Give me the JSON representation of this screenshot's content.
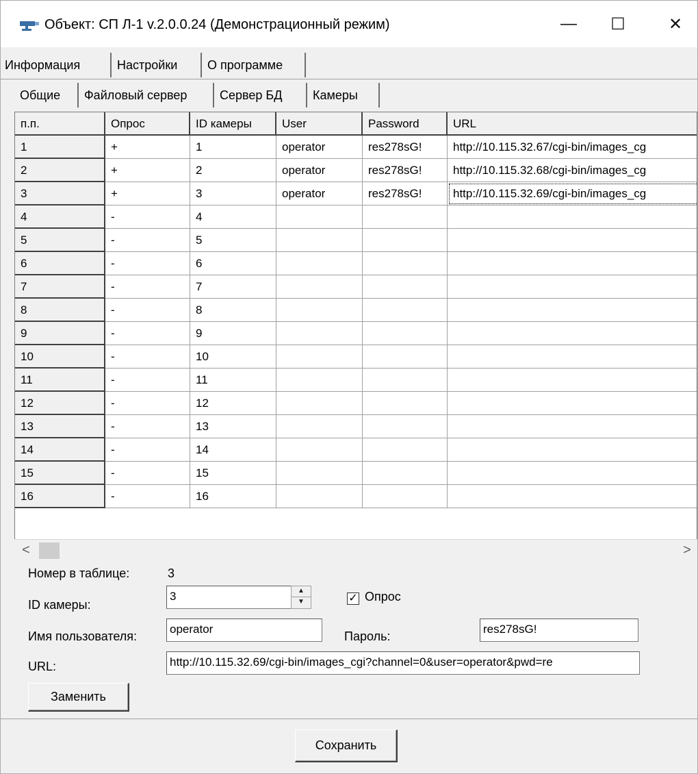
{
  "window": {
    "title": "Объект: СП Л-1 v.2.0.0.24 (Демонстрационный режим)",
    "minimize": "—",
    "maximize": "☐",
    "close": "✕"
  },
  "main_tabs": [
    {
      "label": "Информация"
    },
    {
      "label": "Настройки"
    },
    {
      "label": "О программе"
    }
  ],
  "sub_tabs": [
    {
      "label": "Общие"
    },
    {
      "label": "Файловый сервер"
    },
    {
      "label": "Сервер БД"
    },
    {
      "label": "Камеры"
    }
  ],
  "table": {
    "columns": [
      "п.п.",
      "Опрос",
      "ID камеры",
      "User",
      "Password",
      "URL"
    ],
    "rows": [
      [
        "1",
        "+",
        "1",
        "operator",
        "res278sG!",
        "http://10.115.32.67/cgi-bin/images_cg"
      ],
      [
        "2",
        "+",
        "2",
        "operator",
        "res278sG!",
        "http://10.115.32.68/cgi-bin/images_cg"
      ],
      [
        "3",
        "+",
        "3",
        "operator",
        "res278sG!",
        "http://10.115.32.69/cgi-bin/images_cg"
      ],
      [
        "4",
        "-",
        "4",
        "",
        "",
        ""
      ],
      [
        "5",
        "-",
        "5",
        "",
        "",
        ""
      ],
      [
        "6",
        "-",
        "6",
        "",
        "",
        ""
      ],
      [
        "7",
        "-",
        "7",
        "",
        "",
        ""
      ],
      [
        "8",
        "-",
        "8",
        "",
        "",
        ""
      ],
      [
        "9",
        "-",
        "9",
        "",
        "",
        ""
      ],
      [
        "10",
        "-",
        "10",
        "",
        "",
        ""
      ],
      [
        "11",
        "-",
        "11",
        "",
        "",
        ""
      ],
      [
        "12",
        "-",
        "12",
        "",
        "",
        ""
      ],
      [
        "13",
        "-",
        "13",
        "",
        "",
        ""
      ],
      [
        "14",
        "-",
        "14",
        "",
        "",
        ""
      ],
      [
        "15",
        "-",
        "15",
        "",
        "",
        ""
      ],
      [
        "16",
        "-",
        "16",
        "",
        "",
        ""
      ]
    ]
  },
  "scroll": {
    "left": "<",
    "right": ">"
  },
  "form": {
    "row_number_label": "Номер в таблице:",
    "row_number_value": "3",
    "camera_id_label": "ID камеры:",
    "camera_id_value": "3",
    "poll_label": "Опрос",
    "poll_checked": "✓",
    "user_label": "Имя пользователя:",
    "user_value": "operator",
    "password_label": "Пароль:",
    "password_value": "res278sG!",
    "url_label": "URL:",
    "url_value": "http://10.115.32.69/cgi-bin/images_cgi?channel=0&user=operator&pwd=re",
    "replace_button": "Заменить"
  },
  "save_button": "Сохранить",
  "colors": {
    "window_bg": "#f0f0f0",
    "grid_bg": "#ffffff",
    "fixed_cell_bg": "#f0f0f0"
  }
}
